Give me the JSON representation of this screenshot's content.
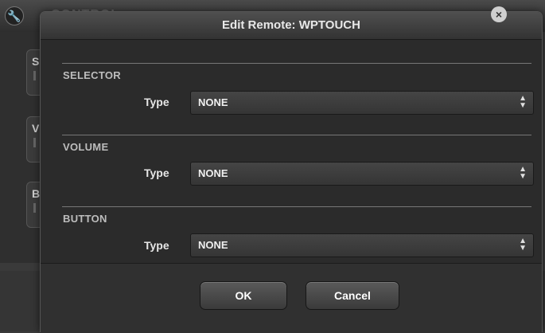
{
  "background": {
    "header_title": "CONTROL",
    "cards": [
      {
        "letter": "S"
      },
      {
        "letter": "V"
      },
      {
        "letter": "B"
      }
    ]
  },
  "dialog": {
    "title": "Edit Remote: WPTOUCH",
    "close_glyph": "×",
    "sections": [
      {
        "label": "SELECTOR",
        "type_label": "Type",
        "value": "NONE"
      },
      {
        "label": "VOLUME",
        "type_label": "Type",
        "value": "NONE"
      },
      {
        "label": "BUTTON",
        "type_label": "Type",
        "value": "NONE"
      }
    ],
    "buttons": {
      "ok": "OK",
      "cancel": "Cancel"
    }
  },
  "icons": {
    "wrench": "wrench-icon",
    "close": "close-icon",
    "select_arrows": "up-down-arrows-icon"
  }
}
